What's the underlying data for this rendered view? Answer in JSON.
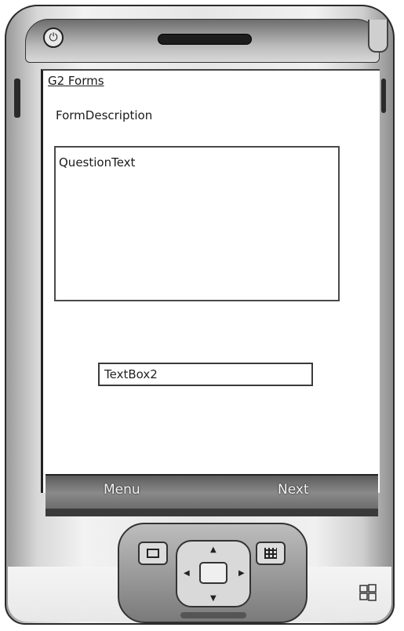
{
  "app": {
    "title": "G2 Forms",
    "form_description": "FormDescription",
    "question_text": "QuestionText",
    "textbox_value": "TextBox2"
  },
  "softkeys": {
    "left_label": "Menu",
    "right_label": "Next"
  },
  "device": {
    "power_icon": "power-icon",
    "windows_logo": "windows-logo-icon",
    "body_color": "#e6e6e6",
    "softkey_bar_color": "#6a6a6a"
  }
}
